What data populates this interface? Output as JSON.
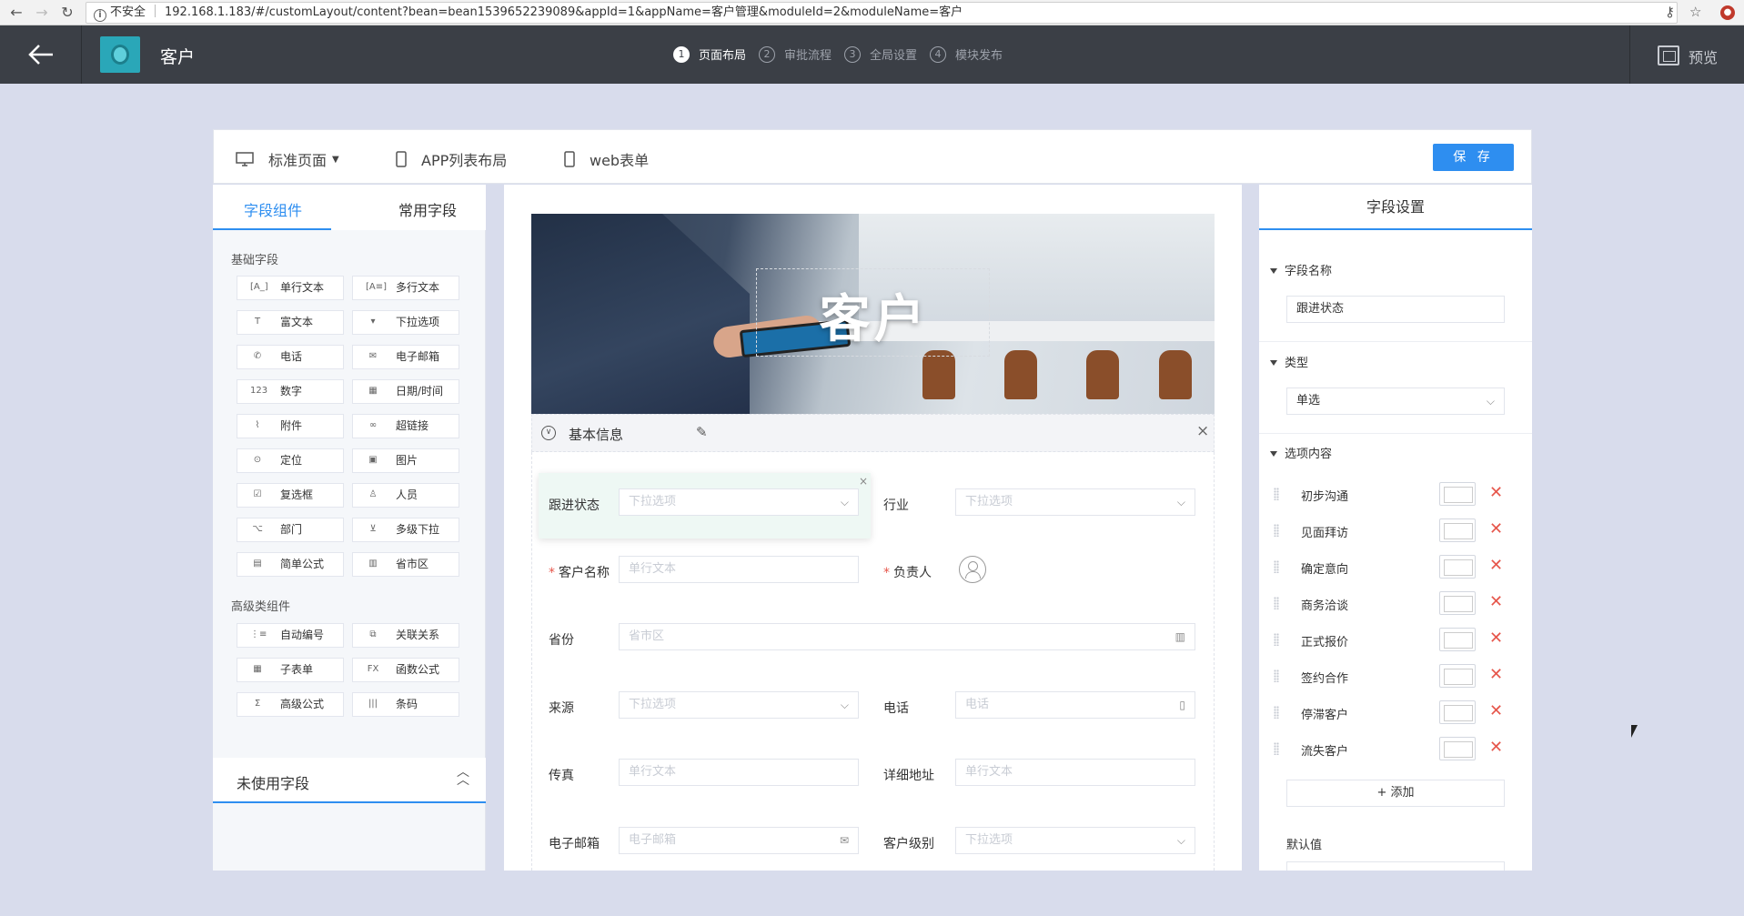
{
  "browser": {
    "insecure_label": "不安全",
    "url": "192.168.1.183/#/customLayout/content?bean=bean1539652239089&appId=1&appName=客户管理&moduleId=2&moduleName=客户"
  },
  "header": {
    "module_title": "客户",
    "steps": [
      {
        "num": "1",
        "label": "页面布局",
        "active": true
      },
      {
        "num": "2",
        "label": "审批流程",
        "active": false
      },
      {
        "num": "3",
        "label": "全局设置",
        "active": false
      },
      {
        "num": "4",
        "label": "模块发布",
        "active": false
      }
    ],
    "preview_label": "预览"
  },
  "toolbar": {
    "standard_page": "标准页面",
    "app_list_layout": "APP列表布局",
    "web_form": "web表单",
    "save_label": "保 存"
  },
  "left_panel": {
    "tabs": [
      "字段组件",
      "常用字段"
    ],
    "basic_title": "基础字段",
    "basic_fields": [
      {
        "label": "单行文本",
        "icon": "single-line-text-icon",
        "glyph": "[A_]"
      },
      {
        "label": "多行文本",
        "icon": "multi-line-text-icon",
        "glyph": "[A≡]"
      },
      {
        "label": "富文本",
        "icon": "rich-text-icon",
        "glyph": "T"
      },
      {
        "label": "下拉选项",
        "icon": "dropdown-icon",
        "glyph": "▾"
      },
      {
        "label": "电话",
        "icon": "phone-icon",
        "glyph": "✆"
      },
      {
        "label": "电子邮箱",
        "icon": "email-icon",
        "glyph": "✉"
      },
      {
        "label": "数字",
        "icon": "number-icon",
        "glyph": "123"
      },
      {
        "label": "日期/时间",
        "icon": "calendar-icon",
        "glyph": "▦"
      },
      {
        "label": "附件",
        "icon": "paperclip-icon",
        "glyph": "⌇"
      },
      {
        "label": "超链接",
        "icon": "link-icon",
        "glyph": "∞"
      },
      {
        "label": "定位",
        "icon": "location-pin-icon",
        "glyph": "⊙"
      },
      {
        "label": "图片",
        "icon": "image-icon",
        "glyph": "▣"
      },
      {
        "label": "复选框",
        "icon": "checkbox-icon",
        "glyph": "☑"
      },
      {
        "label": "人员",
        "icon": "person-icon",
        "glyph": "♙"
      },
      {
        "label": "部门",
        "icon": "department-tree-icon",
        "glyph": "⌥"
      },
      {
        "label": "多级下拉",
        "icon": "cascade-dropdown-icon",
        "glyph": "⊻"
      },
      {
        "label": "简单公式",
        "icon": "simple-formula-icon",
        "glyph": "▤"
      },
      {
        "label": "省市区",
        "icon": "region-map-icon",
        "glyph": "▥"
      }
    ],
    "advanced_title": "高级类组件",
    "advanced_fields": [
      {
        "label": "自动编号",
        "icon": "auto-number-icon",
        "glyph": "⋮≡"
      },
      {
        "label": "关联关系",
        "icon": "relation-icon",
        "glyph": "⧉"
      },
      {
        "label": "子表单",
        "icon": "subform-table-icon",
        "glyph": "▦"
      },
      {
        "label": "函数公式",
        "icon": "function-formula-icon",
        "glyph": "FX"
      },
      {
        "label": "高级公式",
        "icon": "sigma-icon",
        "glyph": "Σ"
      },
      {
        "label": "条码",
        "icon": "barcode-icon",
        "glyph": "|||"
      }
    ],
    "unused_label": "未使用字段"
  },
  "canvas": {
    "banner_title": "客户",
    "section_title": "基本信息",
    "fields": {
      "follow_status": {
        "label": "跟进状态",
        "placeholder": "下拉选项"
      },
      "industry": {
        "label": "行业",
        "placeholder": "下拉选项"
      },
      "customer_name": {
        "label": "客户名称",
        "placeholder": "单行文本"
      },
      "owner": {
        "label": "负责人"
      },
      "province": {
        "label": "省份",
        "placeholder": "省市区"
      },
      "source": {
        "label": "来源",
        "placeholder": "下拉选项"
      },
      "phone": {
        "label": "电话",
        "placeholder": "电话"
      },
      "fax": {
        "label": "传真",
        "placeholder": "单行文本"
      },
      "address": {
        "label": "详细地址",
        "placeholder": "单行文本"
      },
      "email": {
        "label": "电子邮箱",
        "placeholder": "电子邮箱"
      },
      "level": {
        "label": "客户级别",
        "placeholder": "下拉选项"
      }
    }
  },
  "right_panel": {
    "title": "字段设置",
    "field_name_label": "字段名称",
    "field_name_value": "跟进状态",
    "type_label": "类型",
    "type_value": "单选",
    "options_label": "选项内容",
    "options": [
      "初步沟通",
      "见面拜访",
      "确定意向",
      "商务洽谈",
      "正式报价",
      "签约合作",
      "停滞客户",
      "流失客户"
    ],
    "add_label": "+ 添加",
    "default_label": "默认值"
  }
}
